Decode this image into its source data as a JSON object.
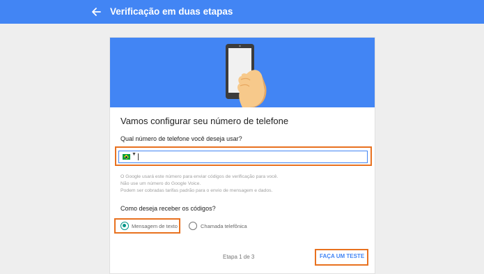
{
  "header": {
    "title": "Verificação em duas etapas",
    "back_icon": "arrow-back-icon"
  },
  "illustration": {
    "icon": "phone-in-hand-illustration"
  },
  "card": {
    "title": "Vamos configurar seu número de telefone",
    "phone_question": "Qual número de telefone você deseja usar?",
    "phone_input": {
      "value": "",
      "country_flag": "brazil-flag-icon"
    },
    "help_lines": [
      "O Google usará este número para enviar códigos de verificação para você.",
      "Não use um número do Google Voice.",
      "Podem ser cobradas tarifas padrão para o envio de mensagem e dados."
    ],
    "codes_question": "Como deseja receber os códigos?",
    "options": [
      {
        "label": "Mensagem de texto",
        "selected": true
      },
      {
        "label": "Chamada telefônica",
        "selected": false
      }
    ],
    "step_text": "Etapa 1 de 3",
    "test_button": "FAÇA UM TESTE"
  },
  "colors": {
    "primary": "#4285f4",
    "radio_selected": "#009688",
    "highlight": "#e8711f",
    "background": "#eeeeee"
  }
}
